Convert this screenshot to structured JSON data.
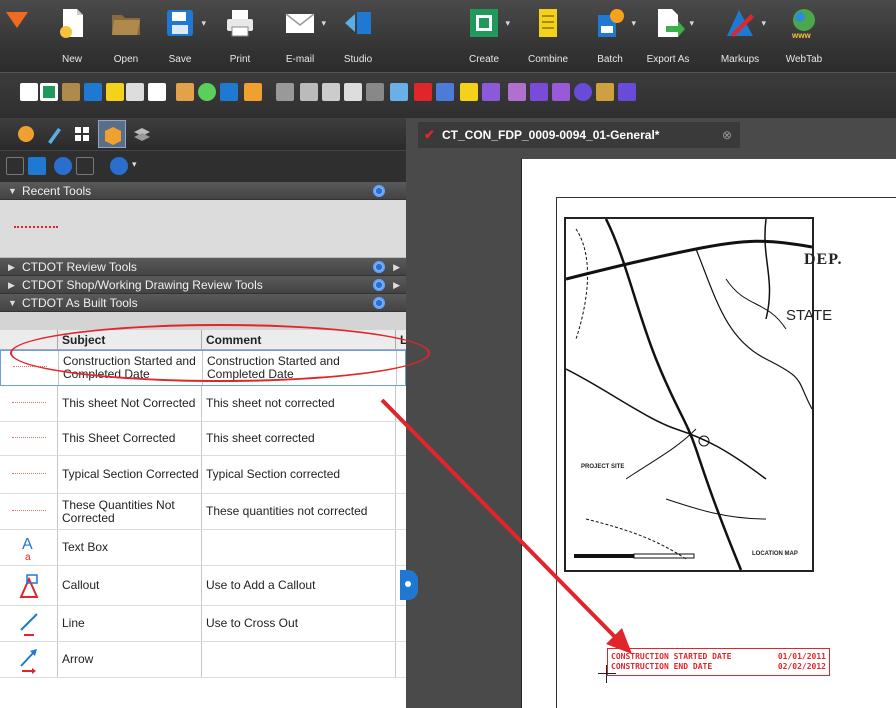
{
  "ribbon": {
    "buttons": [
      {
        "label": "New",
        "icon": "new-document-icon"
      },
      {
        "label": "Open",
        "icon": "folder-icon"
      },
      {
        "label": "Save",
        "icon": "floppy-disk-icon"
      },
      {
        "label": "Print",
        "icon": "printer-icon"
      },
      {
        "label": "E-mail",
        "icon": "envelope-icon"
      },
      {
        "label": "Studio",
        "icon": "studio-icon"
      },
      {
        "label": "Create",
        "icon": "create-icon"
      },
      {
        "label": "Combine",
        "icon": "combine-icon"
      },
      {
        "label": "Batch",
        "icon": "batch-icon"
      },
      {
        "label": "Export As",
        "icon": "export-icon"
      },
      {
        "label": "Markups",
        "icon": "markups-icon"
      },
      {
        "label": "WebTab",
        "icon": "webtab-icon"
      }
    ]
  },
  "panel": {
    "sections": {
      "recent": "Recent Tools",
      "review": "CTDOT Review Tools",
      "shop": "CTDOT Shop/Working Drawing Review Tools",
      "asbuilt": "CTDOT As Built Tools"
    },
    "columns": {
      "subject": "Subject",
      "comment": "Comment",
      "extra": "L"
    },
    "rows": [
      {
        "subject": "Construction Started and Completed Date",
        "comment": "Construction Started and Completed Date",
        "icon": "stamp-icon"
      },
      {
        "subject": "This sheet Not Corrected",
        "comment": "This sheet not corrected",
        "icon": "stamp-icon"
      },
      {
        "subject": "This Sheet Corrected",
        "comment": "This sheet corrected",
        "icon": "stamp-icon"
      },
      {
        "subject": "Typical Section Corrected",
        "comment": "Typical Section corrected",
        "icon": "stamp-icon"
      },
      {
        "subject": "These Quantities Not Corrected",
        "comment": "These quantities not corrected",
        "icon": "stamp-icon"
      },
      {
        "subject": "Text Box",
        "comment": "",
        "icon": "text-box-icon"
      },
      {
        "subject": "Callout",
        "comment": "Use to Add a Callout",
        "icon": "callout-icon"
      },
      {
        "subject": "Line",
        "comment": "Use to Cross Out",
        "icon": "line-icon"
      },
      {
        "subject": "Arrow",
        "comment": "",
        "icon": "arrow-icon"
      }
    ]
  },
  "document": {
    "tab_title": "CT_CON_FDP_0009-0094_01-General*",
    "dept_text": "DEP.",
    "state_text": "STATE",
    "project_site": "PROJECT SITE",
    "location_map": "LOCATION MAP",
    "stamp": {
      "line1_label": "CONSTRUCTION STARTED DATE",
      "line1_value": "01/01/2011",
      "line2_label": "CONSTRUCTION END DATE",
      "line2_value": "02/02/2012"
    }
  },
  "colors": {
    "accent": "#e0262a",
    "brand_blue": "#1f78d1"
  }
}
